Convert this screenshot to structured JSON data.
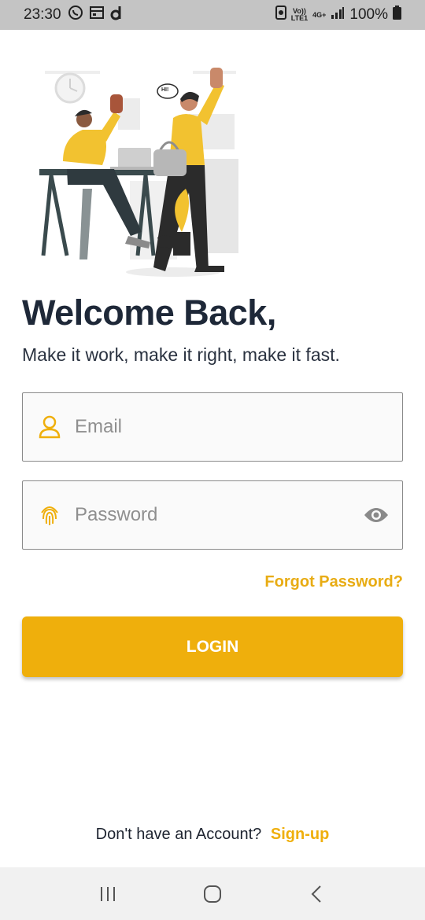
{
  "status_bar": {
    "time": "23:30",
    "network_label_top": "Vo))",
    "network_label_bottom": "LTE1",
    "signal_label": "4G+",
    "battery_percent": "100%"
  },
  "illustration": {
    "speech_bubble": "HI!"
  },
  "login": {
    "title": "Welcome Back,",
    "subtitle": "Make it work, make it right, make it fast.",
    "email_placeholder": "Email",
    "password_placeholder": "Password",
    "forgot_label": "Forgot Password?",
    "login_label": "LOGIN",
    "no_account_text": "Don't have an Account?",
    "signup_label": "Sign-up"
  },
  "colors": {
    "accent": "#efaf0c",
    "title": "#1e2838"
  }
}
